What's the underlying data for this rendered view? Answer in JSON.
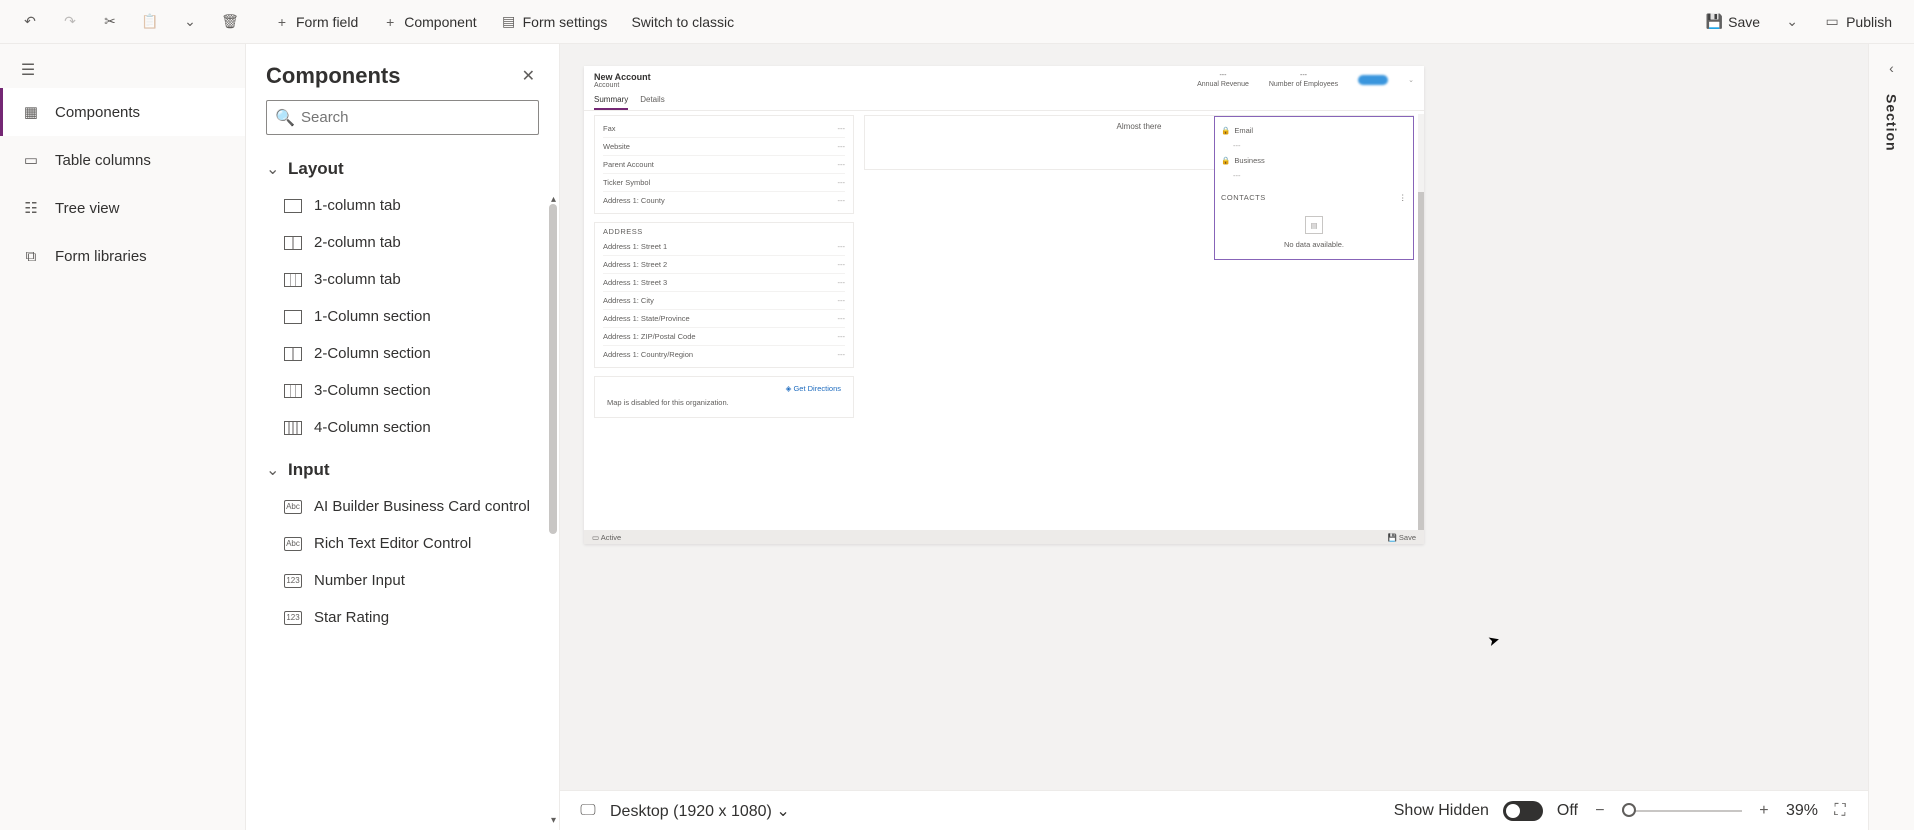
{
  "toolbar": {
    "form_field": "Form field",
    "component": "Component",
    "form_settings": "Form settings",
    "switch_classic": "Switch to classic",
    "save": "Save",
    "publish": "Publish"
  },
  "left_rail": {
    "items": [
      {
        "label": "Components"
      },
      {
        "label": "Table columns"
      },
      {
        "label": "Tree view"
      },
      {
        "label": "Form libraries"
      }
    ]
  },
  "components_panel": {
    "title": "Components",
    "search_placeholder": "Search",
    "groups": {
      "layout": {
        "title": "Layout",
        "items": [
          "1-column tab",
          "2-column tab",
          "3-column tab",
          "1-Column section",
          "2-Column section",
          "3-Column section",
          "4-Column section"
        ]
      },
      "input": {
        "title": "Input",
        "items": [
          "AI Builder Business Card control",
          "Rich Text Editor Control",
          "Number Input",
          "Star Rating"
        ]
      }
    }
  },
  "form_preview": {
    "title": "New Account",
    "entity": "Account",
    "header_meta": [
      "Annual Revenue",
      "Number of Employees"
    ],
    "tabs": [
      "Summary",
      "Details"
    ],
    "detail_rows": [
      {
        "label": "Fax",
        "value": "---"
      },
      {
        "label": "Website",
        "value": "---"
      },
      {
        "label": "Parent Account",
        "value": "---"
      },
      {
        "label": "Ticker Symbol",
        "value": "---"
      },
      {
        "label": "Address 1: County",
        "value": "---"
      }
    ],
    "address_section": {
      "title": "ADDRESS",
      "rows": [
        {
          "label": "Address 1: Street 1",
          "value": "---"
        },
        {
          "label": "Address 1: Street 2",
          "value": "---"
        },
        {
          "label": "Address 1: Street 3",
          "value": "---"
        },
        {
          "label": "Address 1: City",
          "value": "---"
        },
        {
          "label": "Address 1: State/Province",
          "value": "---"
        },
        {
          "label": "Address 1: ZIP/Postal Code",
          "value": "---"
        },
        {
          "label": "Address 1: Country/Region",
          "value": "---"
        }
      ]
    },
    "get_directions": "Get Directions",
    "map_disabled": "Map is disabled for this organization.",
    "timeline_msg": "Almost there",
    "right_panel": {
      "email": "Email",
      "business": "Business",
      "contacts_title": "CONTACTS",
      "no_data": "No data available."
    },
    "footer_status": "Active",
    "footer_save": "Save"
  },
  "bottom_bar": {
    "device": "Desktop (1920 x 1080)",
    "show_hidden": "Show Hidden",
    "toggle_state": "Off",
    "zoom": "39%"
  },
  "right_rail": {
    "label": "Section"
  }
}
